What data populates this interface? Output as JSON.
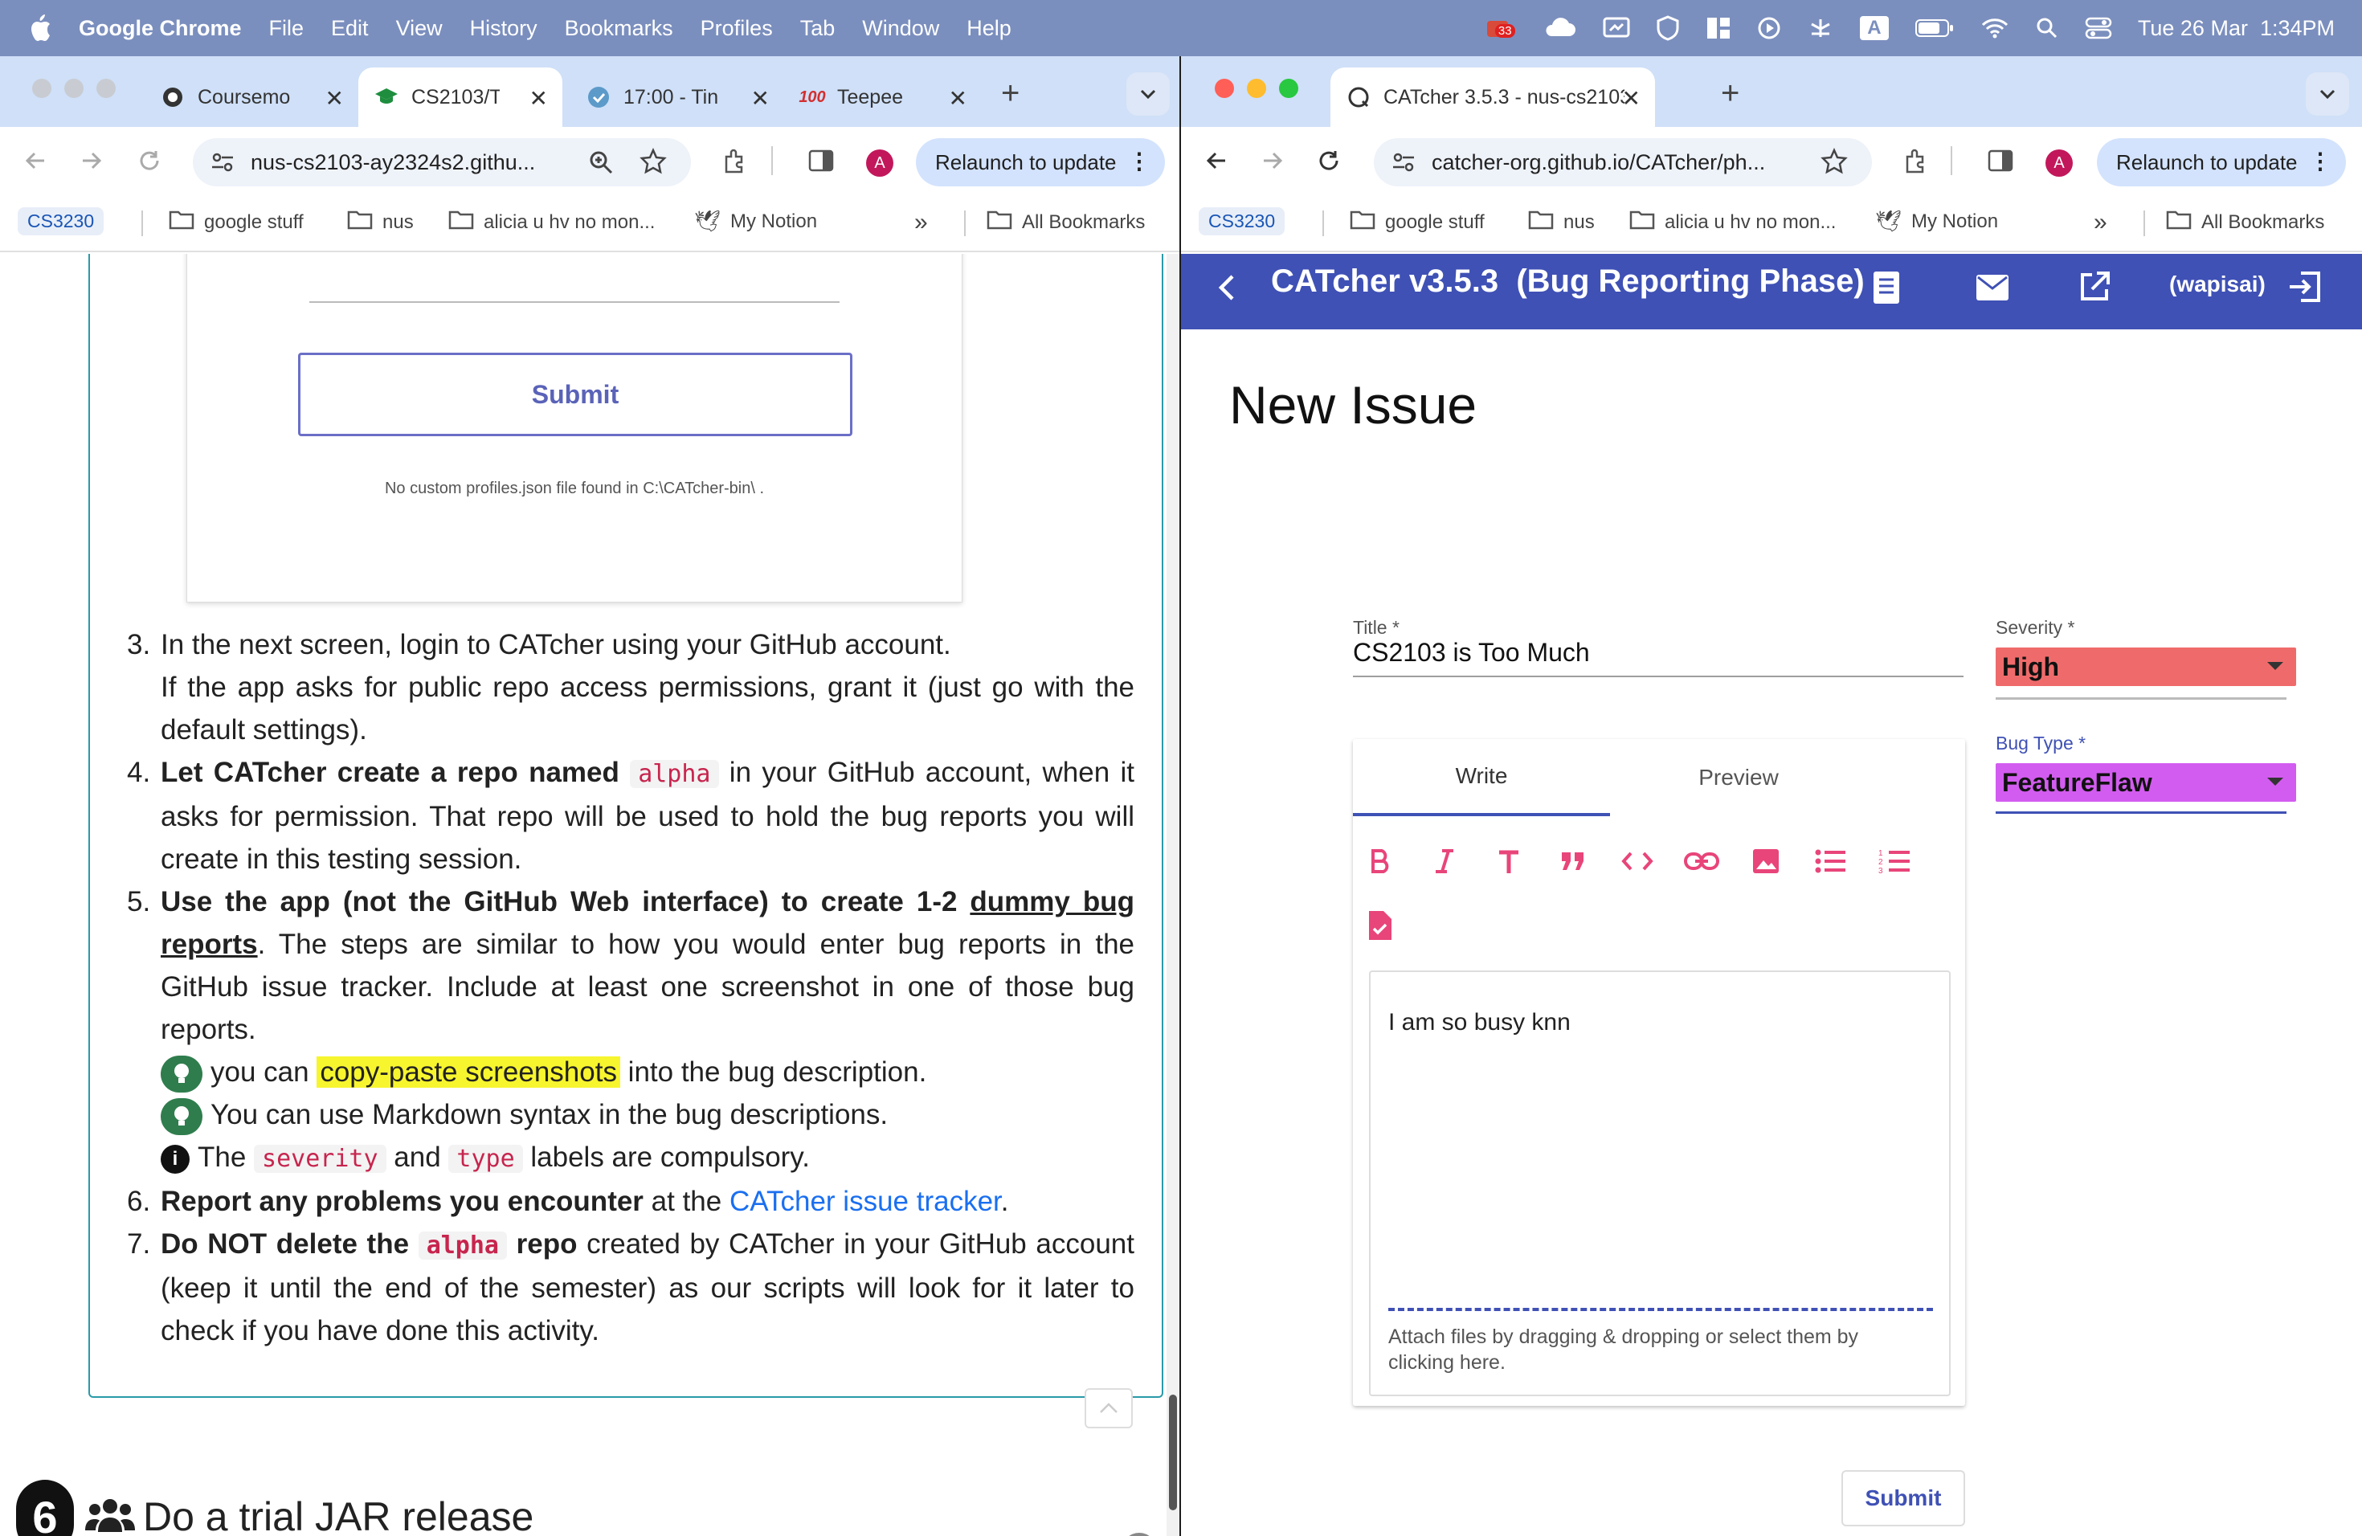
{
  "menubar": {
    "app": "Google Chrome",
    "items": [
      "File",
      "Edit",
      "View",
      "History",
      "Bookmarks",
      "Profiles",
      "Tab",
      "Window",
      "Help"
    ],
    "badge_count": "33",
    "input_letter": "A",
    "datetime": "Tue 26 Mar  1:34PM"
  },
  "left_window": {
    "tabs": [
      {
        "title": "Coursemo"
      },
      {
        "title": "CS2103/T"
      },
      {
        "title": "17:00 - Tin"
      },
      {
        "title": "Teepee"
      }
    ],
    "url": "nus-cs2103-ay2324s2.githu...",
    "relaunch": "Relaunch to update",
    "avatar": "A",
    "bookmarks": [
      "CS3230",
      "google stuff",
      "nus",
      "alicia u hv no mon...",
      "My Notion",
      "All Bookmarks"
    ],
    "shot": {
      "submit": "Submit",
      "note": "No custom profiles.json file found in C:\\CATcher-bin\\ ."
    },
    "steps": {
      "s3_num": "3.",
      "s3_a": "In the next screen, login to CATcher using your GitHub account.",
      "s3_b": "If the app asks for public repo access permissions, grant it (just go with the default settings).",
      "s4_num": "4.",
      "s4_bold": "Let CATcher create a repo named",
      "s4_code": "alpha",
      "s4_rest": " in your GitHub account, when it asks for permission. That repo will be used to hold the bug reports you will create in this testing session.",
      "s5_num": "5.",
      "s5_bold": "Use the app (not the GitHub Web interface) to create 1-2 ",
      "s5_u": "dummy bug reports",
      "s5_rest": ". The steps are similar to how you would enter bug reports in the GitHub issue tracker. Include at least one screenshot in one of those bug reports.",
      "tip1_pre": "you can ",
      "tip1_hl": "copy-paste screenshots",
      "tip1_post": " into the bug description.",
      "tip2": "You can use Markdown syntax in the bug descriptions.",
      "info_a": "The ",
      "info_code1": "severity",
      "info_b": " and ",
      "info_code2": "type",
      "info_c": " labels are compulsory.",
      "s6_num": "6.",
      "s6_bold": "Report any problems you encounter",
      "s6_mid": " at the ",
      "s6_link": "CATcher issue tracker",
      "s6_end": ".",
      "s7_num": "7.",
      "s7_bold1": "Do NOT delete the ",
      "s7_code": "alpha",
      "s7_bold2": " repo",
      "s7_rest": " created by CATcher in your GitHub account (keep it until the end of the semester) as our scripts will look for it later to check if you have done this activity."
    },
    "section": {
      "number": "6",
      "title": "Do a trial JAR release"
    }
  },
  "right_window": {
    "tab_title": "CATcher 3.5.3 - nus-cs2103-",
    "url": "catcher-org.github.io/CATcher/ph...",
    "relaunch": "Relaunch to update",
    "avatar": "A",
    "bookmarks": [
      "CS3230",
      "google stuff",
      "nus",
      "alicia u hv no mon...",
      "My Notion",
      "All Bookmarks"
    ],
    "app_title": "CATcher v3.5.3  (Bug Reporting Phase)",
    "user": "(wapisai)",
    "heading": "New Issue",
    "title_label": "Title *",
    "title_value": "CS2103 is Too Much",
    "severity_label": "Severity *",
    "severity_value": "High",
    "bugtype_label": "Bug Type *",
    "bugtype_value": "FeatureFlaw",
    "tab_write": "Write",
    "tab_preview": "Preview",
    "body_text": "I am so busy knn",
    "attach_text": "Attach files by dragging & dropping or select them by clicking here.",
    "submit": "Submit"
  },
  "colors": {
    "appbar": "#3f51b5",
    "severity_high": "#ef6b6b",
    "bugtype_featureflaw": "#d35cf0",
    "accent_pink": "#e8457a"
  }
}
